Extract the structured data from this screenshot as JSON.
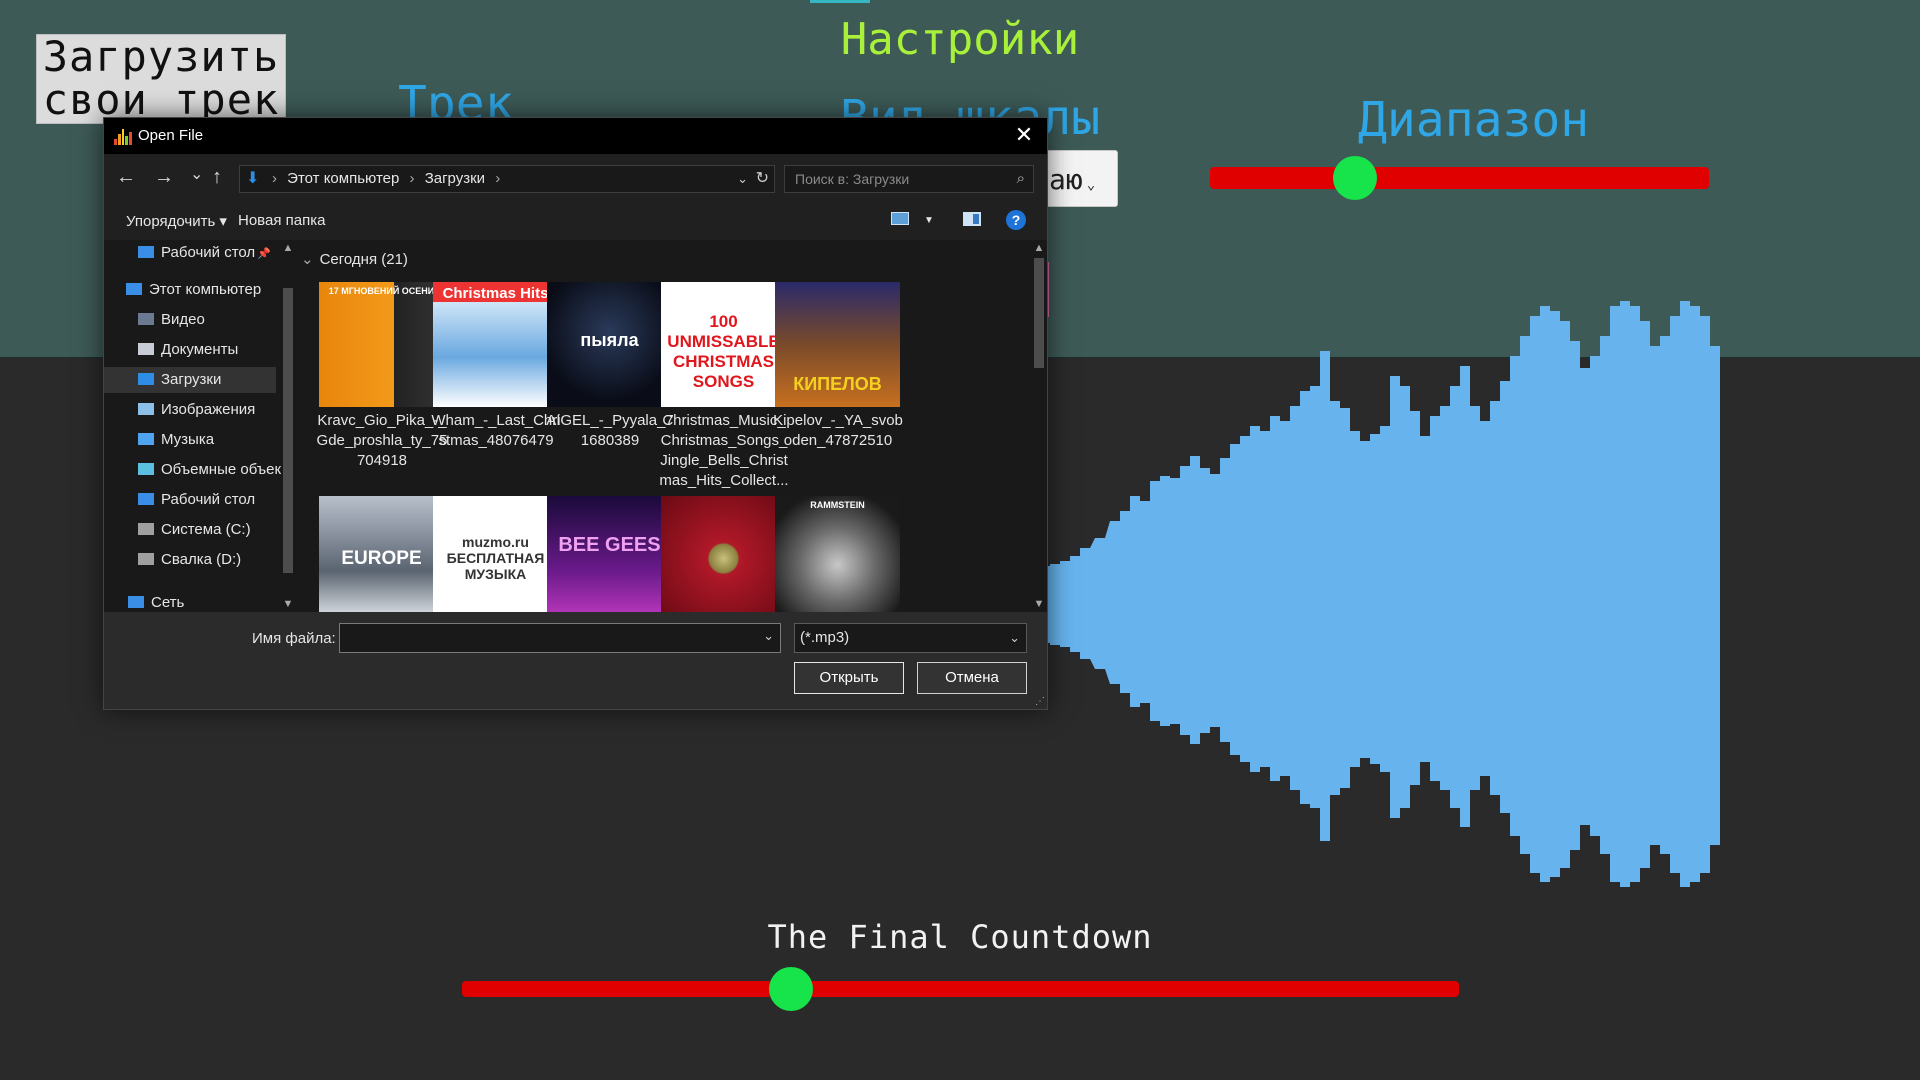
{
  "settings": {
    "title": "Настройки",
    "upload_button": [
      "Загрузить",
      "свои трек"
    ],
    "label_track": "Трек",
    "label_scale": "Вид шкалы",
    "label_range": "Диапазон",
    "scale_select_value": "аю",
    "range_slider_fraction": 0.29
  },
  "player": {
    "track_title": "The Final Countdown",
    "seek_fraction": 0.33
  },
  "colors": {
    "panel_bg": "#3d5a57",
    "title_color": "#a8f03a",
    "label_color": "#2fa6e6",
    "slider_track": "#e00000",
    "slider_knob": "#17e34a",
    "waveform": "#66b3ee"
  },
  "dialog": {
    "title": "Open File",
    "close_icon": "close-icon",
    "nav": {
      "back": "←",
      "forward": "→",
      "recent": "⌄",
      "up": "↑"
    },
    "address": [
      "Этот компьютер",
      "Загрузки"
    ],
    "search_placeholder": "Поиск в: Загрузки",
    "toolbar": {
      "organize": "Упорядочить ▾",
      "new_folder": "Новая папка"
    },
    "sidebar": [
      {
        "label": "Рабочий стол",
        "icon": "desktop-icon",
        "pinned": true
      },
      {
        "label": "Этот компьютер",
        "icon": "computer-icon"
      },
      {
        "label": "Видео",
        "icon": "video-icon"
      },
      {
        "label": "Документы",
        "icon": "documents-icon"
      },
      {
        "label": "Загрузки",
        "icon": "downloads-icon",
        "selected": true
      },
      {
        "label": "Изображения",
        "icon": "images-icon"
      },
      {
        "label": "Музыка",
        "icon": "music-icon"
      },
      {
        "label": "Объемные объекты",
        "icon": "3d-objects-icon"
      },
      {
        "label": "Рабочий стол",
        "icon": "desktop-icon"
      },
      {
        "label": "Система (C:)",
        "icon": "drive-icon"
      },
      {
        "label": "Свалка (D:)",
        "icon": "drive-icon"
      },
      {
        "label": "Сеть",
        "icon": "network-icon"
      }
    ],
    "group_header": "Сегодня (21)",
    "files": [
      {
        "name": "Kravc_Gio_Pika_-_Gde_proshla_ty_75704918",
        "thumb_text": "17 МГНОВЕНИЙ ОСЕНИ"
      },
      {
        "name": "Wham_-_Last_Christmas_48076479",
        "thumb_text": "Christmas Hits"
      },
      {
        "name": "AIGEL_-_Pyyala_71680389",
        "thumb_text": "пыяла"
      },
      {
        "name": "Christmas_Music_Christmas_Songs_Jingle_Bells_Christmas_Hits_Collect...",
        "thumb_text": "100 UNMISSABLE CHRISTMAS SONGS"
      },
      {
        "name": "Kipelov_-_YA_svoboden_47872510",
        "thumb_text": "КИПЕЛОВ"
      },
      {
        "name": "",
        "thumb_text": "EUROPE"
      },
      {
        "name": "",
        "thumb_text": "muzmo.ru БЕСПЛАТНАЯ МУЗЫКА"
      },
      {
        "name": "",
        "thumb_text": "BEE GEES"
      },
      {
        "name": "",
        "thumb_text": ""
      },
      {
        "name": "",
        "thumb_text": "RAMMSTEIN"
      }
    ],
    "filename_label": "Имя файла:",
    "filename_value": "",
    "filter": "(*.mp3)",
    "open_button": "Открыть",
    "cancel_button": "Отмена"
  }
}
